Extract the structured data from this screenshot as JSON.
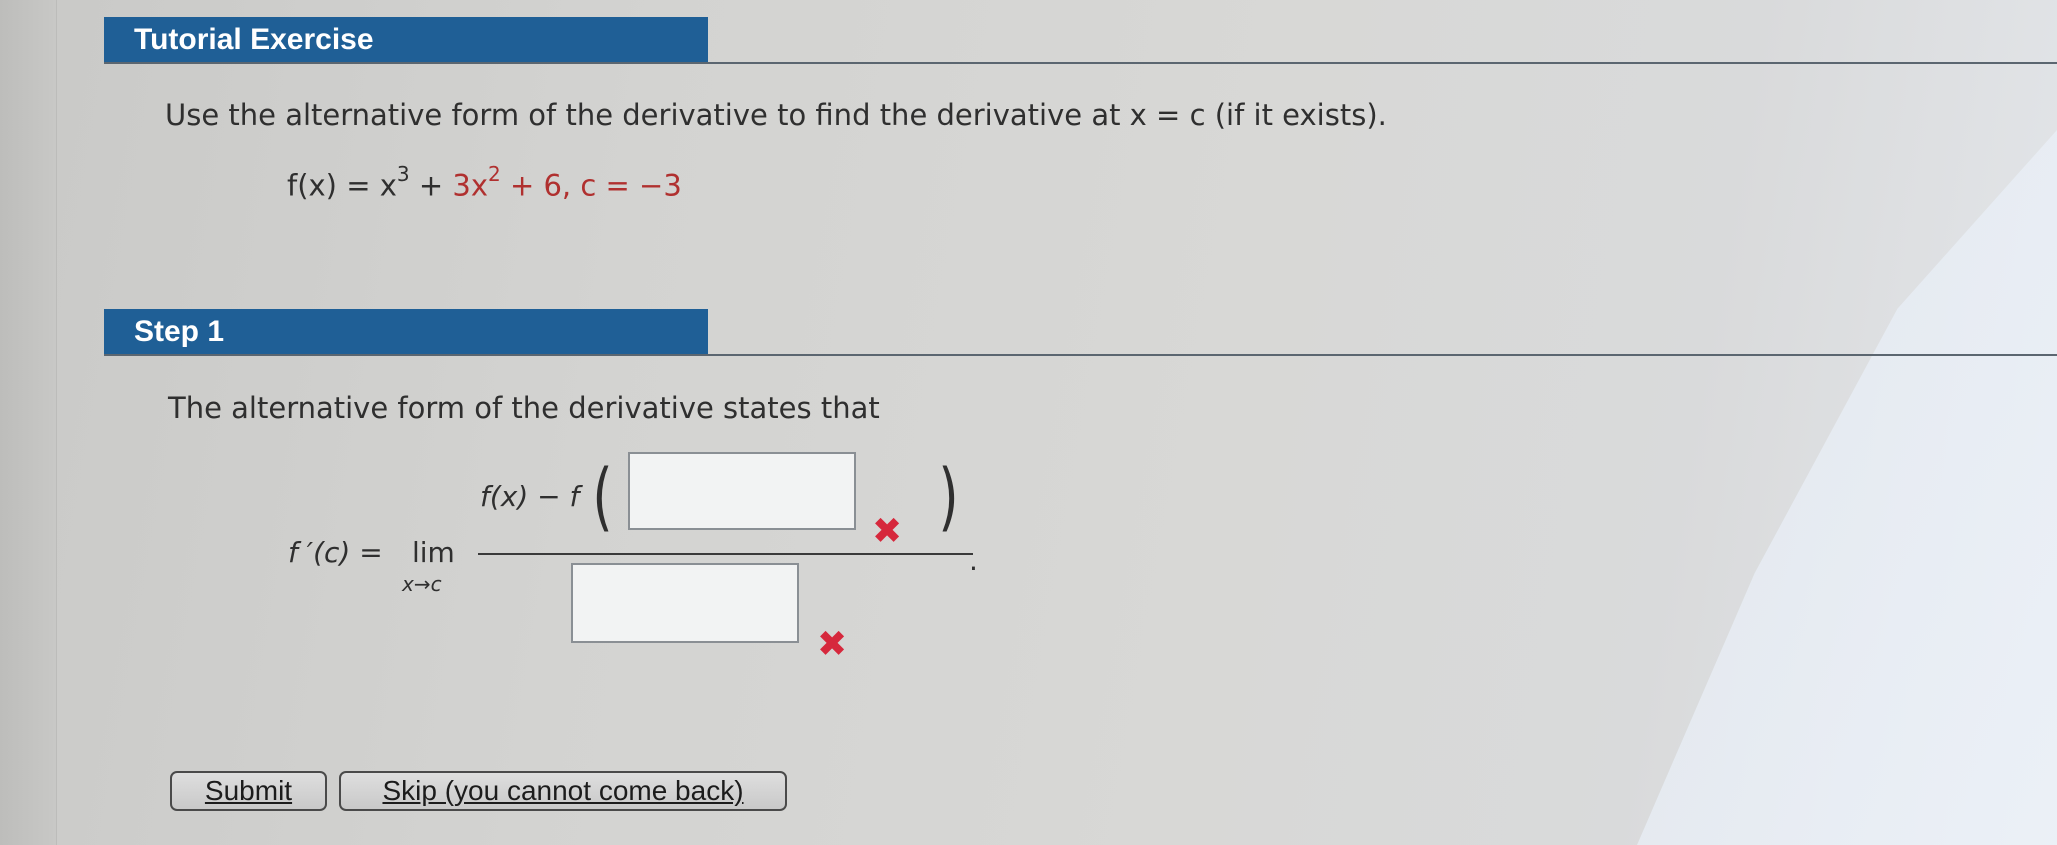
{
  "tutorial": {
    "header": "Tutorial Exercise",
    "prompt": "Use the alternative form of the derivative to find the derivative at x = c (if it exists).",
    "equation": {
      "lhs": "f(x) = x",
      "exp1": "3",
      "plus1": " + ",
      "term2": "3x",
      "exp2": "2",
      "term3": " + 6, c = −3"
    }
  },
  "step1": {
    "header": "Step 1",
    "intro": "The alternative form of the derivative states that",
    "formula": {
      "lhs": "f ′(c)  =",
      "lim": "lim",
      "lim_sub": "x→c",
      "numerator_prefix": "f(x) − f",
      "period": "."
    },
    "answer_boxes": [
      {
        "value": "",
        "status": "incorrect"
      },
      {
        "value": "",
        "status": "incorrect"
      }
    ],
    "incorrect_mark": "✖"
  },
  "buttons": {
    "submit": "Submit",
    "skip": "Skip (you cannot come back)"
  },
  "colors": {
    "header_bg": "#1f5f96",
    "incorrect_mark": "#d6283c",
    "value_red": "#b0302f"
  }
}
